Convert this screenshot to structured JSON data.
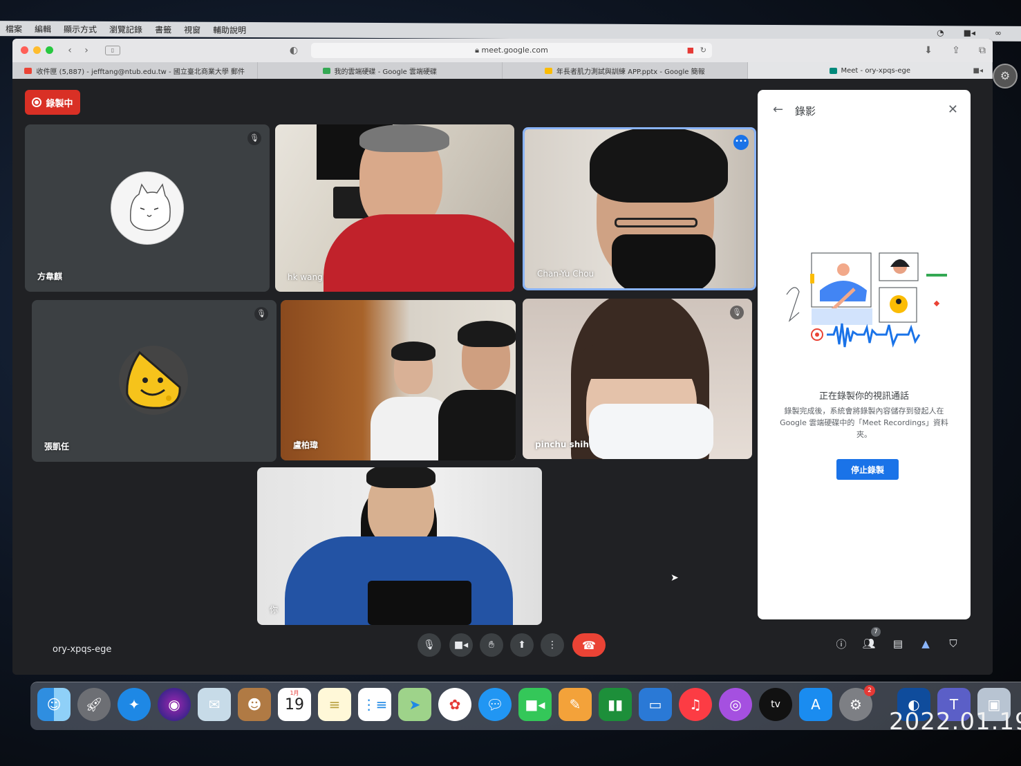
{
  "menubar": {
    "items": [
      "檔案",
      "編輯",
      "顯示方式",
      "瀏覽記錄",
      "書籤",
      "視窗",
      "輔助說明"
    ]
  },
  "browser": {
    "url": "meet.google.com",
    "tabs": [
      {
        "label": "收件匣 (5,887) - jefftang@ntub.edu.tw - 國立臺北商業大學 郵件",
        "favicon_color": "#ea4335"
      },
      {
        "label": "我的雲端硬碟 - Google 雲端硬碟",
        "favicon_color": "#34a853"
      },
      {
        "label": "年長者肌力測試與訓練 APP.pptx - Google 簡報",
        "favicon_color": "#fbbc04"
      },
      {
        "label": "Meet - ory-xpqs-ege",
        "favicon_color": "#00897b"
      }
    ]
  },
  "meet": {
    "recording_badge": "錄製中",
    "meeting_code": "ory-xpqs-ege",
    "participant_count": "7",
    "participants": [
      {
        "name": "方韋麒",
        "muted": true,
        "type": "avatar"
      },
      {
        "name": "hk wang",
        "muted": false,
        "type": "video"
      },
      {
        "name": "Chan-Yu Chou",
        "muted": false,
        "type": "video",
        "active_speaker": true
      },
      {
        "name": "張凱任",
        "muted": true,
        "type": "avatar"
      },
      {
        "name": "盧柏瑋",
        "muted": false,
        "type": "video"
      },
      {
        "name": "pinchu shih",
        "muted": true,
        "type": "video"
      },
      {
        "name": "你",
        "muted": false,
        "type": "video"
      }
    ],
    "controls": [
      "mic-icon",
      "camera-icon",
      "raise-hand-icon",
      "present-icon",
      "more-options-icon",
      "end-call-icon"
    ],
    "side_controls": [
      "info-icon",
      "people-icon",
      "chat-icon",
      "activities-icon",
      "host-controls-icon"
    ]
  },
  "panel": {
    "title": "錄影",
    "heading": "正在錄製你的視訊通話",
    "description": "錄製完成後，系統會將錄製內容儲存到發起人在 Google 雲端硬碟中的「Meet Recordings」資料夾。",
    "stop_button": "停止錄製"
  },
  "dock": {
    "calendar_month": "1月",
    "calendar_day": "19",
    "settings_badge": "2"
  },
  "photo_date_stamp": "2022.01.19",
  "colors": {
    "meet_bg": "#202124",
    "tile_bg": "#3c4043",
    "recording_red": "#d93025",
    "end_call_red": "#ea4335",
    "primary_blue": "#1a73e8",
    "active_speaker_border": "#8ab4f8"
  }
}
